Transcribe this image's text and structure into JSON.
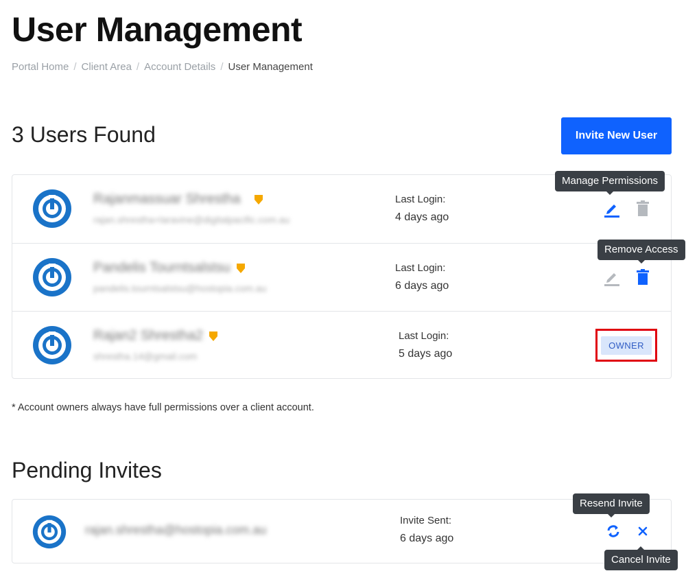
{
  "header": {
    "title": "User Management",
    "breadcrumb": [
      "Portal Home",
      "Client Area",
      "Account Details",
      "User Management"
    ]
  },
  "users_section": {
    "heading": "3 Users Found",
    "invite_button_label": "Invite New User",
    "users": [
      {
        "name": "Rajanmassuar Shrestha",
        "email": "rajan.shrestha+laravine@digitalpacific.com.au",
        "last_login_label": "Last Login:",
        "last_login_value": "4 days ago"
      },
      {
        "name": "Pandelis Tourntsalstsu",
        "email": "pandelis.tourntsalstsu@hostopia.com.au",
        "last_login_label": "Last Login:",
        "last_login_value": "6 days ago"
      },
      {
        "name": "Rajan2 Shrestha2",
        "email": "shrestha.14@gmail.com",
        "last_login_label": "Last Login:",
        "last_login_value": "5 days ago",
        "badge": "OWNER"
      }
    ],
    "note": "* Account owners always have full permissions over a client account."
  },
  "tooltips": {
    "manage_permissions": "Manage Permissions",
    "remove_access": "Remove Access",
    "resend_invite": "Resend Invite",
    "cancel_invite": "Cancel Invite"
  },
  "invites_section": {
    "heading": "Pending Invites",
    "invites": [
      {
        "email": "rajan.shrestha@hostopia.com.au",
        "sent_label": "Invite Sent:",
        "sent_value": "6 days ago"
      }
    ]
  },
  "colors": {
    "primary": "#0f62fe",
    "owner_badge_bg": "#d9e6fb",
    "highlight_border": "#e0000f",
    "shield": "#f5a800",
    "avatar_ring": "#1a73c8",
    "muted_icon": "#b5b9be"
  },
  "icons": {
    "avatar": "power-logo-icon",
    "verified": "shield-icon",
    "edit": "pencil-icon",
    "delete": "trash-icon",
    "resend": "refresh-icon",
    "cancel": "close-icon"
  }
}
